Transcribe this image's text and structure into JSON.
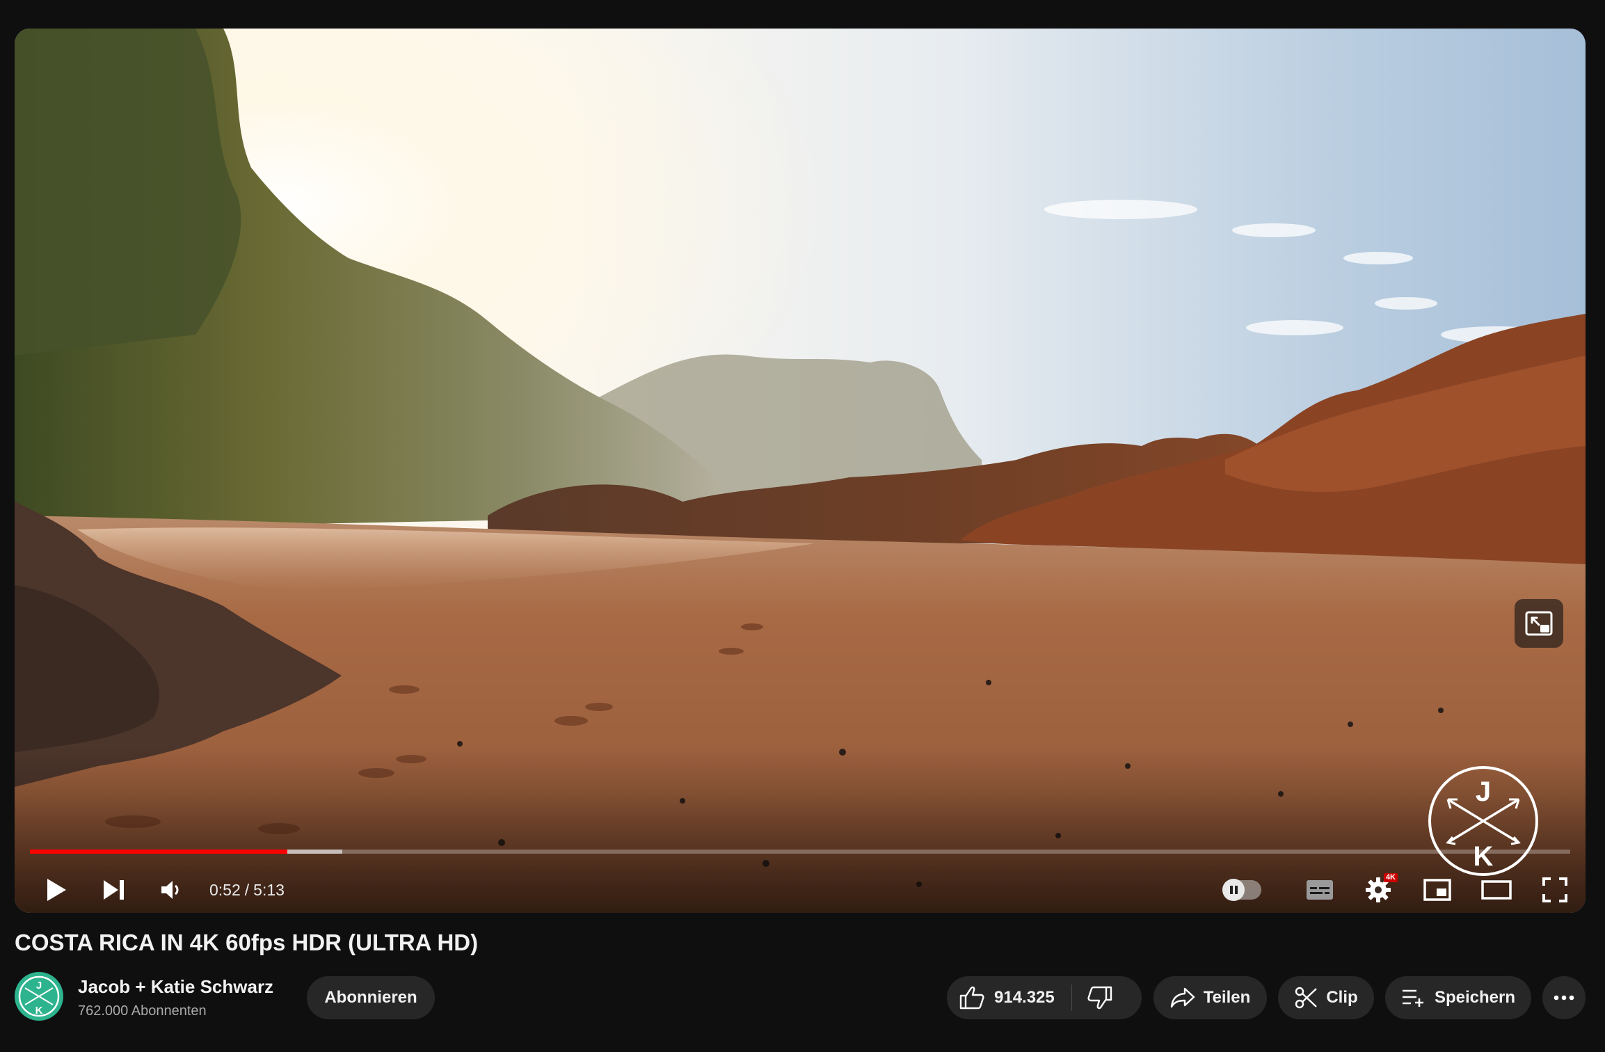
{
  "player": {
    "scene_description_icon": "beach-scene",
    "progress": {
      "played_fraction": 0.167,
      "buffered_fraction": 0.203
    },
    "time": {
      "current": "0:52",
      "separator": "/",
      "duration": "5:13"
    },
    "settings_badge": "4K",
    "accent_color": "#ff0000",
    "icons": {
      "play": "play-icon",
      "next": "next-icon",
      "volume": "volume-icon",
      "autoplay": "autoplay-toggle",
      "subtitles": "subtitles-icon",
      "settings": "gear-icon",
      "miniplayer": "miniplayer-icon",
      "theater": "theater-mode-icon",
      "fullscreen": "fullscreen-icon",
      "pip_overlay": "miniplayer-overlay-icon"
    },
    "watermark": {
      "top_letter": "J",
      "bottom_letter": "K"
    }
  },
  "video": {
    "title": "COSTA RICA IN 4K 60fps HDR (ULTRA HD)"
  },
  "channel": {
    "name": "Jacob + Katie Schwarz",
    "subscribers": "762.000 Abonnenten",
    "avatar_color": "#2db38d",
    "avatar_letters": {
      "top": "J",
      "bottom": "K"
    }
  },
  "actions": {
    "subscribe_label": "Abonnieren",
    "like_count": "914.325",
    "share_label": "Teilen",
    "clip_label": "Clip",
    "save_label": "Speichern"
  }
}
